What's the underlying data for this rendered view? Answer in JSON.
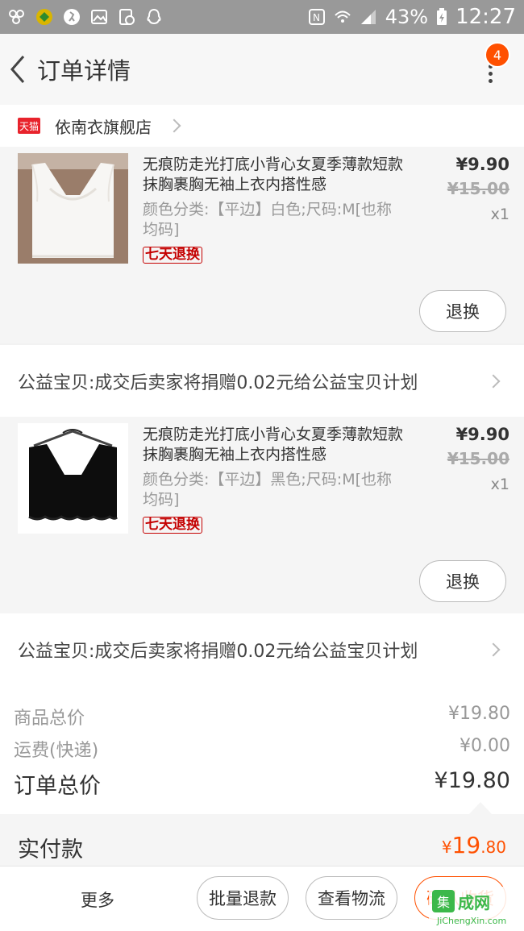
{
  "status_bar": {
    "signal_percent": "43%",
    "time": "12:27",
    "icons": [
      "app-icon",
      "app-icon",
      "app-icon",
      "image-icon",
      "app-icon",
      "qq-icon",
      "nfc-icon",
      "wifi-icon",
      "signal-icon",
      "battery-icon"
    ]
  },
  "nav": {
    "title": "订单详情",
    "badge": "4"
  },
  "shop": {
    "badge_text": "天猫",
    "name": "依南衣旗舰店"
  },
  "items": [
    {
      "title": "无痕防走光打底小背心女夏季薄款短款抹胸裹胸无袖上衣内搭性感",
      "sku": "颜色分类:【平边】白色;尺码:M[也称均码]",
      "tag": "七天退换",
      "price": "¥9.90",
      "original_price": "¥15.00",
      "qty": "x1",
      "button": "退换"
    },
    {
      "title": "无痕防走光打底小背心女夏季薄款短款抹胸裹胸无袖上衣内搭性感",
      "sku": "颜色分类:【平边】黑色;尺码:M[也称均码]",
      "tag": "七天退换",
      "price": "¥9.90",
      "original_price": "¥15.00",
      "qty": "x1",
      "button": "退换"
    }
  ],
  "charity": [
    {
      "text": "公益宝贝:成交后卖家将捐赠0.02元给公益宝贝计划"
    },
    {
      "text": "公益宝贝:成交后卖家将捐赠0.02元给公益宝贝计划"
    }
  ],
  "totals": {
    "goods_label": "商品总价",
    "goods_value": "¥19.80",
    "shipping_label": "运费(快递)",
    "shipping_value": "¥0.00",
    "order_label": "订单总价",
    "order_value": "¥19.80"
  },
  "paid": {
    "label": "实付款",
    "currency": "¥",
    "integer": "19",
    "decimal": ".80"
  },
  "bottom": {
    "more": "更多",
    "batch_refund": "批量退款",
    "view_logistics": "查看物流",
    "confirm_receipt": "确认收货"
  },
  "watermark": {
    "logo": "集",
    "top": "成网",
    "bottom": "JiChengXin.com"
  },
  "colors": {
    "accent": "#ff5000",
    "tmall": "#e8232c",
    "tag": "#c40000",
    "watermark": "#3cb84a"
  }
}
